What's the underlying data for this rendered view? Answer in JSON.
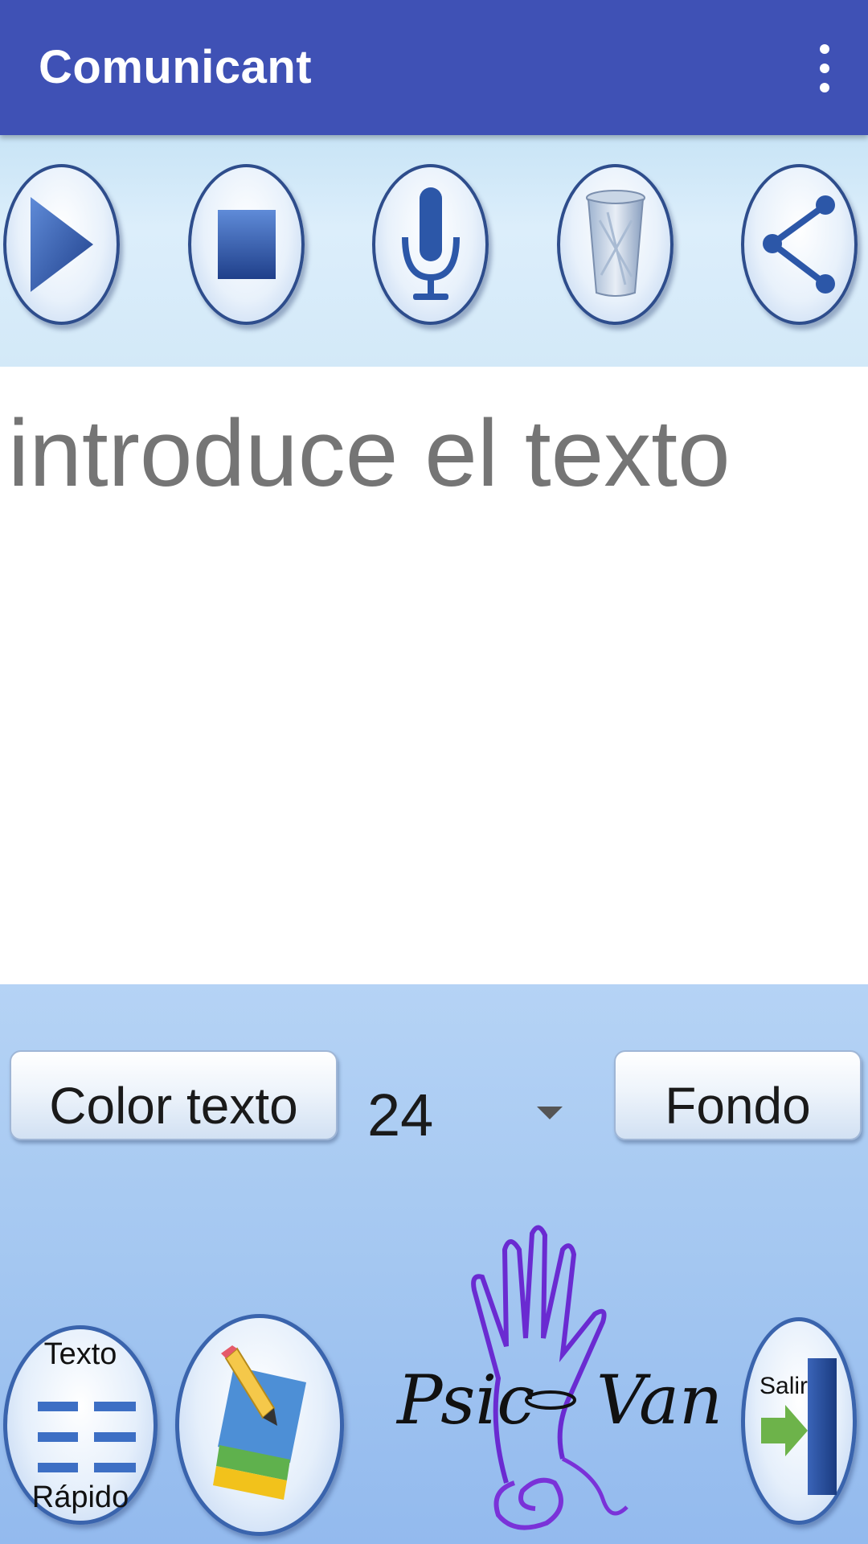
{
  "app_bar": {
    "title": "Comunicant",
    "overflow_icon": "more-vert-icon"
  },
  "toolbar": {
    "buttons": [
      {
        "name": "play",
        "icon": "play-icon"
      },
      {
        "name": "stop",
        "icon": "stop-icon"
      },
      {
        "name": "microphone",
        "icon": "microphone-icon"
      },
      {
        "name": "delete",
        "icon": "trash-icon"
      },
      {
        "name": "share",
        "icon": "share-icon"
      }
    ]
  },
  "editor": {
    "placeholder": "introduce el texto",
    "value": ""
  },
  "controls": {
    "color_text_label": "Color texto",
    "font_size": "24",
    "background_label": "Fondo"
  },
  "bottom": {
    "quick_text_top": "Texto",
    "quick_text_bottom": "Rápido",
    "logo_left": "Psic",
    "logo_right": "Van",
    "exit_label": "Salir"
  },
  "colors": {
    "app_bar": "#3f51b5",
    "toolbar_bg": "#d3e9f8",
    "bottom_bg": "#a4c7f1",
    "icon_blue": "#2c57a8"
  }
}
